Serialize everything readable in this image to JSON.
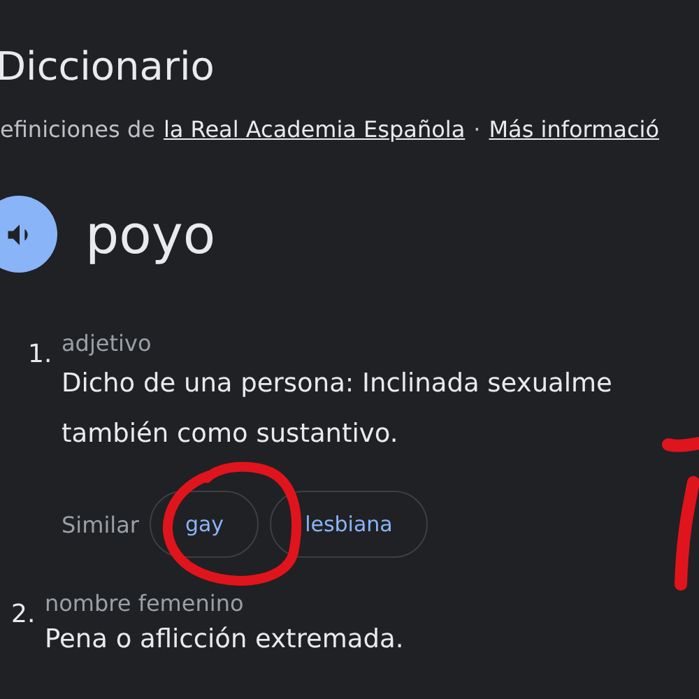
{
  "header": {
    "title": "Diccionario",
    "source_prefix": "efiniciones de",
    "source_link": "la Real Academia Española",
    "separator": "·",
    "more_link": "Más informació"
  },
  "entry": {
    "word": "poyo"
  },
  "senses": [
    {
      "number": "1.",
      "category": "adjetivo",
      "lines": [
        "Dicho de una persona: Inclinada sexualme",
        "también como sustantivo."
      ],
      "similar_label": "Similar",
      "similar": [
        "gay",
        "lesbiana"
      ]
    },
    {
      "number": "2.",
      "category": "nombre femenino",
      "lines": [
        "Pena o aflicción extremada."
      ]
    }
  ],
  "annotations": {
    "circle_mark": true,
    "stroke_mark": true
  }
}
